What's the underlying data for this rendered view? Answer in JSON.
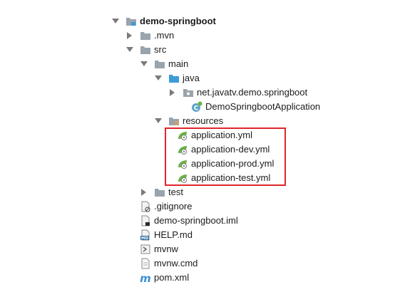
{
  "tree": {
    "project": "demo-springboot",
    "mvn": ".mvn",
    "src": "src",
    "main": "main",
    "java": "java",
    "package": "net.javatv.demo.springboot",
    "app_class": "DemoSpringbootApplication",
    "resources": "resources",
    "yml_files": [
      "application.yml",
      "application-dev.yml",
      "application-prod.yml",
      "application-test.yml"
    ],
    "test": "test",
    "gitignore": ".gitignore",
    "iml": "demo-springboot.iml",
    "help": "HELP.md",
    "mvnw": "mvnw",
    "mvnw_cmd": "mvnw.cmd",
    "pom": "pom.xml"
  },
  "icons": {
    "folder": "folder-icon",
    "source_folder": "source-folder-icon",
    "resources_folder": "resources-folder-icon",
    "package": "package-icon",
    "spring_class": "spring-class-icon",
    "yml": "spring-yml-icon",
    "markdown_badge": "MD",
    "maven_badge": "m"
  },
  "colors": {
    "highlight_border": "#e0262a",
    "folder_gray": "#9aa4ad",
    "source_blue": "#3d9bd6",
    "spring_green": "#6bb344"
  }
}
